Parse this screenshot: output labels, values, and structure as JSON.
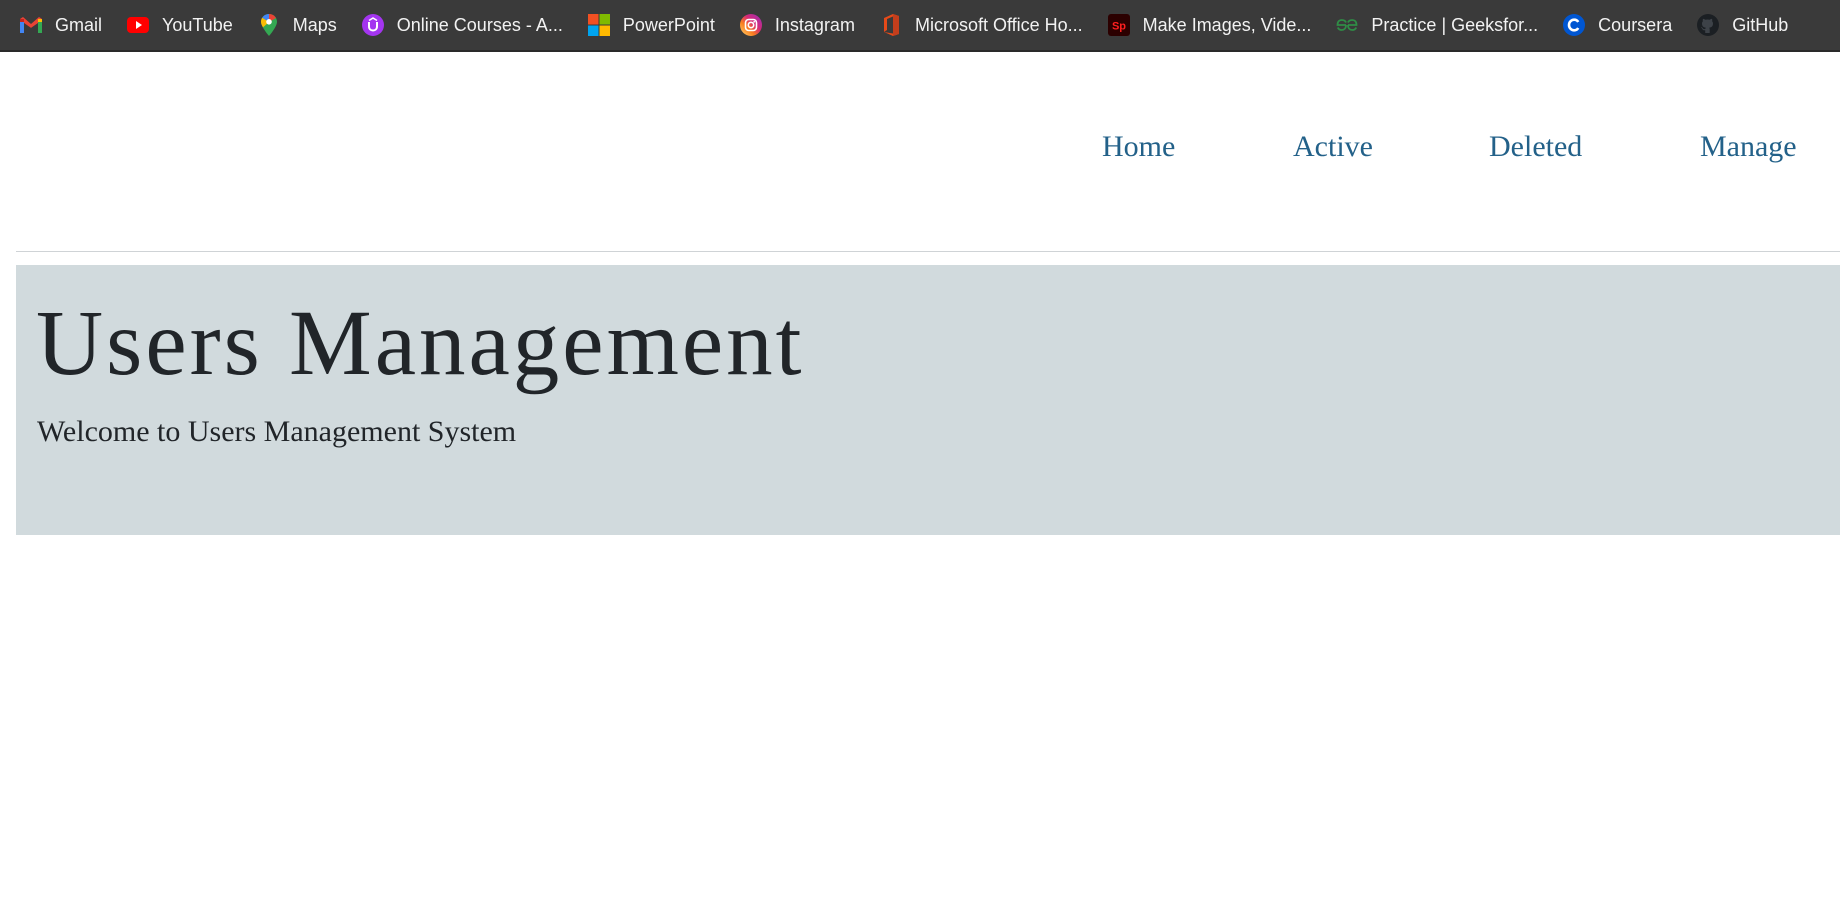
{
  "bookmarks": [
    {
      "label": "Gmail",
      "icon": "gmail-icon"
    },
    {
      "label": "YouTube",
      "icon": "youtube-icon"
    },
    {
      "label": "Maps",
      "icon": "maps-icon"
    },
    {
      "label": "Online Courses - A...",
      "icon": "udemy-icon"
    },
    {
      "label": "PowerPoint",
      "icon": "microsoft-icon"
    },
    {
      "label": "Instagram",
      "icon": "instagram-icon"
    },
    {
      "label": "Microsoft Office Ho...",
      "icon": "office-icon"
    },
    {
      "label": "Make Images, Vide...",
      "icon": "adobe-spark-icon"
    },
    {
      "label": "Practice | Geeksfor...",
      "icon": "geeksforgeeks-icon"
    },
    {
      "label": "Coursera",
      "icon": "coursera-icon"
    },
    {
      "label": "GitHub",
      "icon": "github-icon"
    }
  ],
  "nav": {
    "home": "Home",
    "active": "Active",
    "deleted": "Deleted",
    "manage": "Manage"
  },
  "hero": {
    "title": "Users Management",
    "subtitle": "Welcome to Users Management System"
  },
  "colors": {
    "bookmarks_bar": "#3a3a3a",
    "nav_link": "#236189",
    "jumbotron_bg": "#d1dadd",
    "text": "#212529"
  }
}
